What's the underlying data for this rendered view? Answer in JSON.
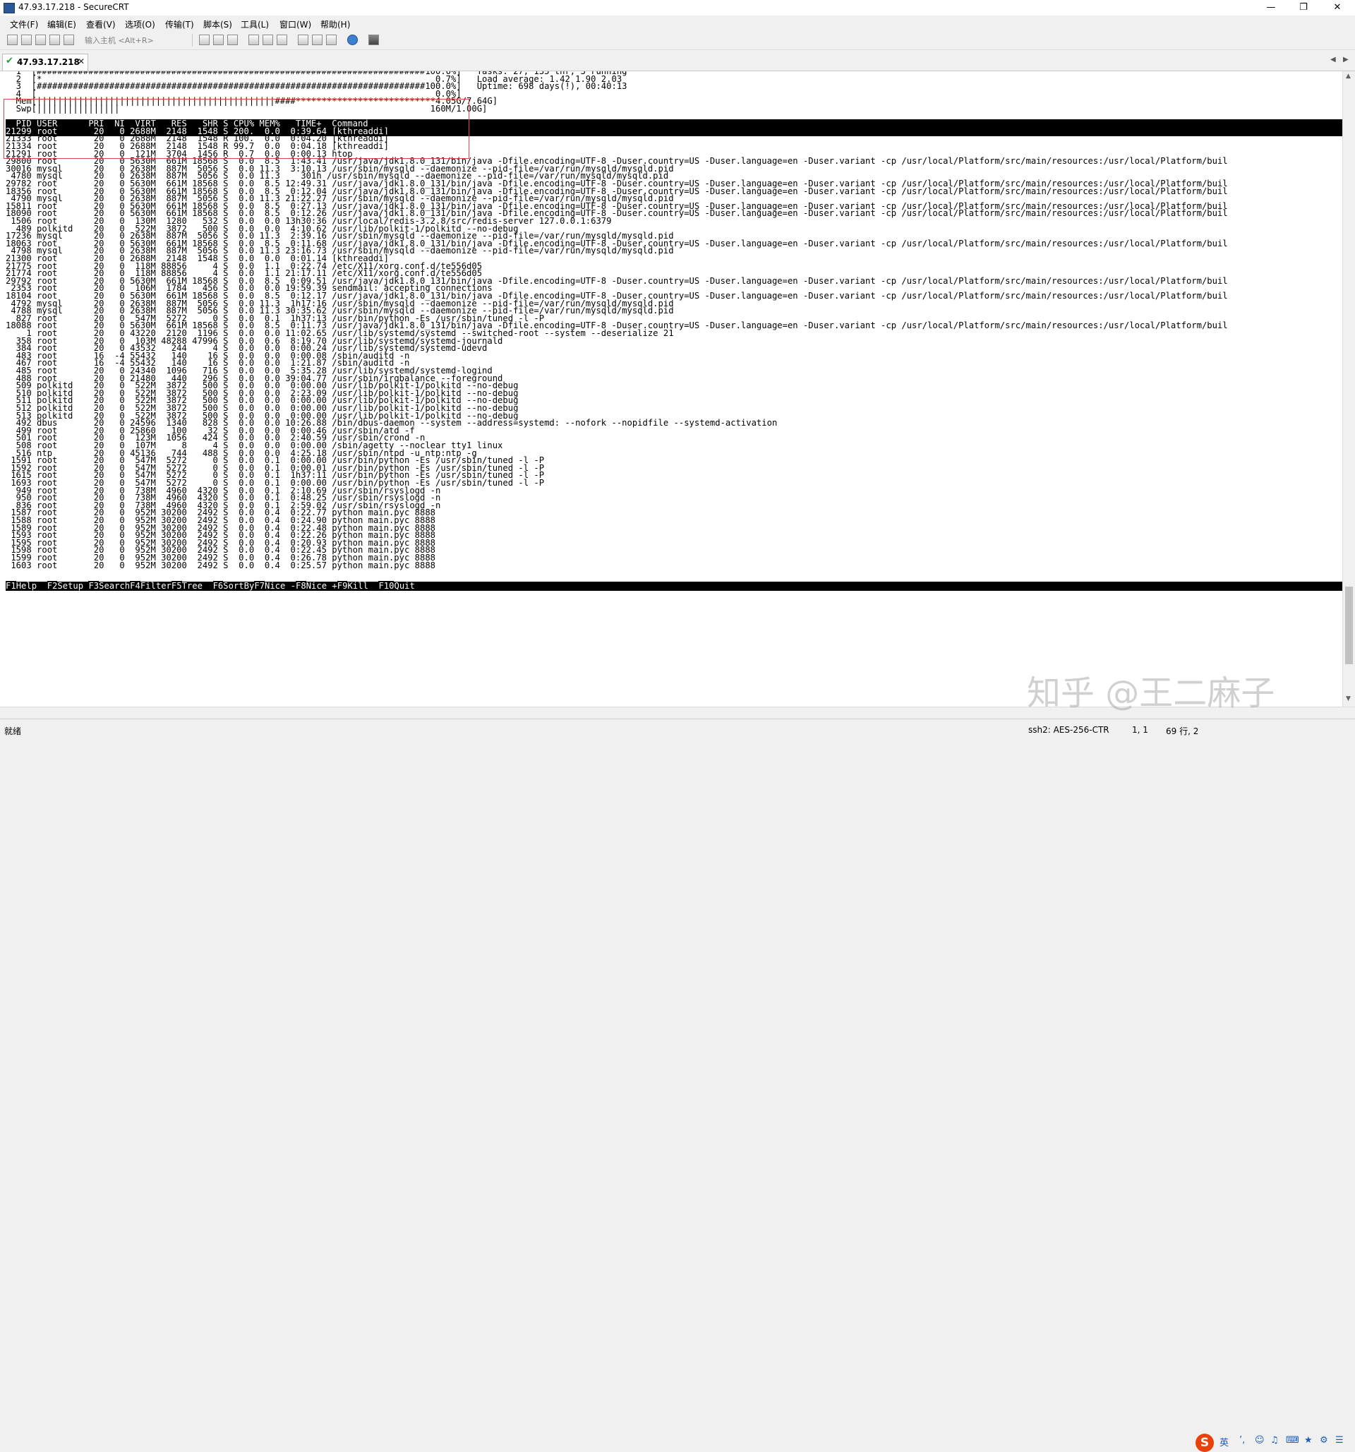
{
  "window": {
    "title": "47.93.17.218 - SecureCRT"
  },
  "menu": [
    "文件(F)",
    "编辑(E)",
    "查看(V)",
    "选项(O)",
    "传输(T)",
    "脚本(S)",
    "工具(L)",
    "窗口(W)",
    "帮助(H)"
  ],
  "toolbar": {
    "host_placeholder": "输入主机 <Alt+R>"
  },
  "tab": {
    "label": "47.93.17.218"
  },
  "terminal": {
    "lines": [
      "  1  [###########################################################################100.0%]   Tasks: 27, 135 thr; 3 running",
      "  2  [*                                                                            0.7%]   Load average: 1.42 1.90 2.03",
      "  3  [###########################################################################100.0%]   Uptime: 698 days(!), 00:40:13",
      "  4  [                                                                             0.0%]",
      "  Mem[||||||||||||||||||||||||||||||||||||||||||||||####***************************4.05G/7.64G]",
      "  Swp[||||||||||||||||                                                            160M/1.00G]",
      "",
      "  PID USER      PRI  NI  VIRT   RES   SHR S CPU% MEM%   TIME+  Command                                                                                                                  ",
      "21299 root       20   0 2688M  2148  1548 S 200.  0.0  0:39.64 [kthreaddi]",
      "21333 root       20   0 2688M  2148  1548 R 100.  0.0  0:04.20 [kthreaddi]",
      "21334 root       20   0 2688M  2148  1548 R 99.7  0.0  0:04.18 [kthreaddi]",
      "21291 root       20   0  121M  3704  1456 R  0.7  0.0  0:00.13 htop",
      "29800 root       20   0 5630M  661M 18568 S  0.0  8.5  1:43.41 /usr/java/jdk1.8.0_131/bin/java -Dfile.encoding=UTF-8 -Duser.country=US -Duser.language=en -Duser.variant -cp /usr/local/Platform/src/main/resources:/usr/local/Platform/buil",
      "30016 mysql      20   0 2638M  887M  5056 S  0.0 11.3  3:10.13 /usr/sbin/mysqld --daemonize --pid-file=/var/run/mysqld/mysqld.pid",
      " 4780 mysql      20   0 2638M  887M  5056 S  0.0 11.3    301h /usr/sbin/mysqld --daemonize --pid-file=/var/run/mysqld/mysqld.pid",
      "29782 root       20   0 5630M  661M 18568 S  0.0  8.5 12:49.31 /usr/java/jdk1.8.0_131/bin/java -Dfile.encoding=UTF-8 -Duser.country=US -Duser.language=en -Duser.variant -cp /usr/local/Platform/src/main/resources:/usr/local/Platform/buil",
      "18356 root       20   0 5630M  661M 18568 S  0.0  8.5  0:12.04 /usr/java/jdk1.8.0_131/bin/java -Dfile.encoding=UTF-8 -Duser.country=US -Duser.language=en -Duser.variant -cp /usr/local/Platform/src/main/resources:/usr/local/Platform/buil",
      " 4790 mysql      20   0 2638M  887M  5056 S  0.0 11.3 21:22.27 /usr/sbin/mysqld --daemonize --pid-file=/var/run/mysqld/mysqld.pid",
      "15811 root       20   0 5630M  661M 18568 S  0.0  8.5  0:27.13 /usr/java/jdk1.8.0_131/bin/java -Dfile.encoding=UTF-8 -Duser.country=US -Duser.language=en -Duser.variant -cp /usr/local/Platform/src/main/resources:/usr/local/Platform/buil",
      "18090 root       20   0 5630M  661M 18568 S  0.0  8.5  0:12.26 /usr/java/jdk1.8.0_131/bin/java -Dfile.encoding=UTF-8 -Duser.country=US -Duser.language=en -Duser.variant -cp /usr/local/Platform/src/main/resources:/usr/local/Platform/buil",
      " 1506 root       20   0  130M  1280   532 S  0.0  0.0 13h30:36 /usr/local/redis-3.2.8/src/redis-server 127.0.0.1:6379",
      "  489 polkitd    20   0  522M  3872   500 S  0.0  0.0  4:10.62 /usr/lib/polkit-1/polkitd --no-debug",
      "17236 mysql      20   0 2638M  887M  5056 S  0.0 11.3  2:39.16 /usr/sbin/mysqld --daemonize --pid-file=/var/run/mysqld/mysqld.pid",
      "18063 root       20   0 5630M  661M 18568 S  0.0  8.5  0:11.68 /usr/java/jdk1.8.0_131/bin/java -Dfile.encoding=UTF-8 -Duser.country=US -Duser.language=en -Duser.variant -cp /usr/local/Platform/src/main/resources:/usr/local/Platform/buil",
      " 4798 mysql      20   0 2638M  887M  5056 S  0.0 11.3 23:16.73 /usr/sbin/mysqld --daemonize --pid-file=/var/run/mysqld/mysqld.pid",
      "21300 root       20   0 2688M  2148  1548 S  0.0  0.0  0:01.14 [kthreaddi]",
      "21775 root       20   0  118M 88856     4 S  0.0  1.1  0:22.74 /etc/X11/xorg.conf.d/te556d05",
      "21774 root       20   0  118M 88856     4 S  0.0  1.1 21:17.11 /etc/X11/xorg.conf.d/te556d05",
      "29792 root       20   0 5630M  661M 18568 S  0.0  8.5  0:09.51 /usr/java/jdk1.8.0_131/bin/java -Dfile.encoding=UTF-8 -Duser.country=US -Duser.language=en -Duser.variant -cp /usr/local/Platform/src/main/resources:/usr/local/Platform/buil",
      " 2353 root       20   0  106M  1784   456 S  0.0  0.0 19:59.39 sendmail: accepting connections",
      "18104 root       20   0 5630M  661M 18568 S  0.0  8.5  0:12.17 /usr/java/jdk1.8.0_131/bin/java -Dfile.encoding=UTF-8 -Duser.country=US -Duser.language=en -Duser.variant -cp /usr/local/Platform/src/main/resources:/usr/local/Platform/buil",
      " 4792 mysql      20   0 2638M  887M  5056 S  0.0 11.3  1h17:16 /usr/sbin/mysqld --daemonize --pid-file=/var/run/mysqld/mysqld.pid",
      " 4788 mysql      20   0 2638M  887M  5056 S  0.0 11.3 30:35.62 /usr/sbin/mysqld --daemonize --pid-file=/var/run/mysqld/mysqld.pid",
      "  827 root       20   0  547M  5272     0 S  0.0  0.1  1h37:13 /usr/bin/python -Es /usr/sbin/tuned -l -P",
      "18088 root       20   0 5630M  661M 18568 S  0.0  8.5  0:11.73 /usr/java/jdk1.8.0_131/bin/java -Dfile.encoding=UTF-8 -Duser.country=US -Duser.language=en -Duser.variant -cp /usr/local/Platform/src/main/resources:/usr/local/Platform/buil",
      "    1 root       20   0 43220  2120  1196 S  0.0  0.0 11:02.65 /usr/lib/systemd/systemd --switched-root --system --deserialize 21",
      "  358 root       20   0  103M 48288 47996 S  0.0  0.6  8:19.70 /usr/lib/systemd/systemd-journald",
      "  384 root       20   0 43532   244     4 S  0.0  0.0  0:00.24 /usr/lib/systemd/systemd-udevd",
      "  483 root       16  -4 55432   140    16 S  0.0  0.0  0:00.08 /sbin/auditd -n",
      "  467 root       16  -4 55432   140    16 S  0.0  0.0  1:21.87 /sbin/auditd -n",
      "  485 root       20   0 24340  1096   716 S  0.0  0.0  5:35.28 /usr/lib/systemd/systemd-logind",
      "  488 root       20   0 21480   440   296 S  0.0  0.0 39:04.77 /usr/sbin/irqbalance --foreground",
      "  509 polkitd    20   0  522M  3872   500 S  0.0  0.0  0:00.00 /usr/lib/polkit-1/polkitd --no-debug",
      "  510 polkitd    20   0  522M  3872   500 S  0.0  0.0  2:23.09 /usr/lib/polkit-1/polkitd --no-debug",
      "  511 polkitd    20   0  522M  3872   500 S  0.0  0.0  0:00.00 /usr/lib/polkit-1/polkitd --no-debug",
      "  512 polkitd    20   0  522M  3872   500 S  0.0  0.0  0:00.00 /usr/lib/polkit-1/polkitd --no-debug",
      "  513 polkitd    20   0  522M  3872   500 S  0.0  0.0  0:00.00 /usr/lib/polkit-1/polkitd --no-debug",
      "  492 dbus       20   0 24596  1340   828 S  0.0  0.0 10:26.88 /bin/dbus-daemon --system --address=systemd: --nofork --nopidfile --systemd-activation",
      "  499 root       20   0 25860   100    32 S  0.0  0.0  0:00.46 /usr/sbin/atd -f",
      "  501 root       20   0  123M  1056   424 S  0.0  0.0  2:40.59 /usr/sbin/crond -n",
      "  508 root       20   0  107M     8     4 S  0.0  0.0  0:00.00 /sbin/agetty --noclear tty1 linux",
      "  516 ntp        20   0 45136   744   488 S  0.0  0.0  4:25.18 /usr/sbin/ntpd -u ntp:ntp -g",
      " 1591 root       20   0  547M  5272     0 S  0.0  0.1  0:00.00 /usr/bin/python -Es /usr/sbin/tuned -l -P",
      " 1592 root       20   0  547M  5272     0 S  0.0  0.1  0:00.01 /usr/bin/python -Es /usr/sbin/tuned -l -P",
      " 1615 root       20   0  547M  5272     0 S  0.0  0.1  1h37:11 /usr/bin/python -Es /usr/sbin/tuned -l -P",
      " 1693 root       20   0  547M  5272     0 S  0.0  0.1  0:00.00 /usr/bin/python -Es /usr/sbin/tuned -l -P",
      "  949 root       20   0  738M  4960  4320 S  0.0  0.1  2:10.69 /usr/sbin/rsyslogd -n",
      "  950 root       20   0  738M  4960  4320 S  0.0  0.1  0:48.25 /usr/sbin/rsyslogd -n",
      "  836 root       20   0  738M  4960  4320 S  0.0  0.1  2:59.02 /usr/sbin/rsyslogd -n",
      " 1587 root       20   0  952M 30200  2492 S  0.0  0.4  0:22.77 python main.pyc 8888",
      " 1588 root       20   0  952M 30200  2492 S  0.0  0.4  0:24.90 python main.pyc 8888",
      " 1589 root       20   0  952M 30200  2492 S  0.0  0.4  0:22.48 python main.pyc 8888",
      " 1593 root       20   0  952M 30200  2492 S  0.0  0.4  0:22.26 python main.pyc 8888",
      " 1595 root       20   0  952M 30200  2492 S  0.0  0.4  0:20.93 python main.pyc 8888",
      " 1598 root       20   0  952M 30200  2492 S  0.0  0.4  0:22.45 python main.pyc 8888",
      " 1599 root       20   0  952M 30200  2492 S  0.0  0.4  0:26.78 python main.pyc 8888",
      " 1603 root       20   0  952M 30200  2492 S  0.0  0.4  0:25.57 python main.pyc 8888"
    ],
    "header_row": 7,
    "selected_row": 8,
    "function_keys": [
      {
        "key": "F1",
        "label": "Help  "
      },
      {
        "key": "F2",
        "label": "Setup "
      },
      {
        "key": "F3",
        "label": "Search"
      },
      {
        "key": "F4",
        "label": "Filter"
      },
      {
        "key": "F5",
        "label": "Tree  "
      },
      {
        "key": "F6",
        "label": "SortBy"
      },
      {
        "key": "F7",
        "label": "Nice -"
      },
      {
        "key": "F8",
        "label": "Nice +"
      },
      {
        "key": "F9",
        "label": "Kill  "
      },
      {
        "key": "F10",
        "label": "Quit"
      }
    ]
  },
  "watermark": "知乎 @王二麻子",
  "status": {
    "left": "就绪",
    "cipher": "ssh2: AES-256-CTR",
    "pos": "1,  1",
    "rows": "69 行, 2",
    "ime_logo": "S",
    "ime_lang": "英"
  },
  "colors": {
    "terminal_bg": "#ffffff",
    "selection_bg": "#000000",
    "highlight_box": "#e0474c"
  }
}
